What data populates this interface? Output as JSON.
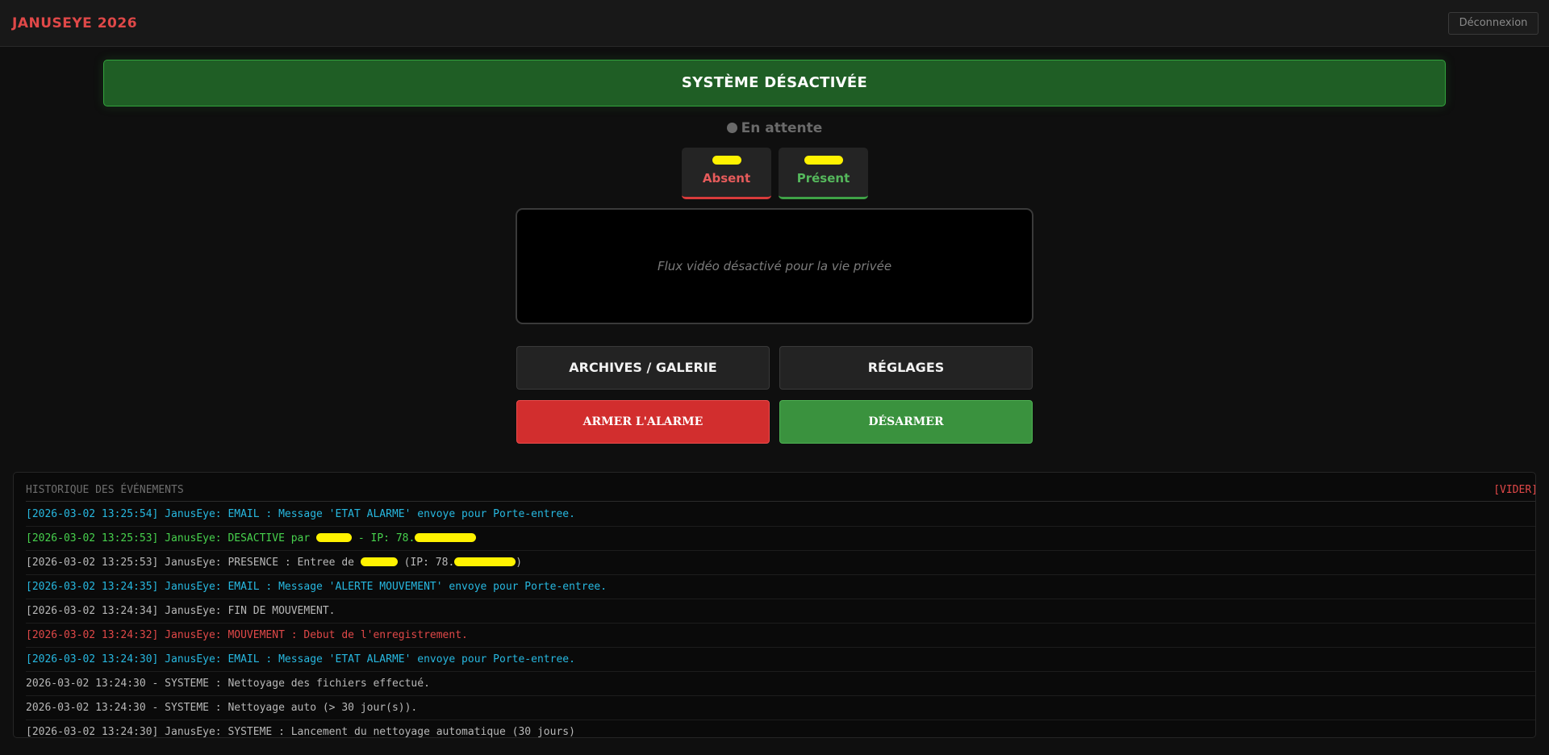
{
  "header": {
    "brand": "JANUSEYE 2026",
    "logout_label": "Déconnexion"
  },
  "status": {
    "banner": "SYSTÈME DÉSACTIVÉE",
    "waiting": "En attente"
  },
  "presence": {
    "absent_label": "Absent",
    "present_label": "Présent"
  },
  "video": {
    "placeholder": "Flux vidéo désactivé pour la vie privée"
  },
  "actions": {
    "archives": "ARCHIVES / GALERIE",
    "settings": "RÉGLAGES",
    "arm": "ARMER L'ALARME",
    "disarm": "DÉSARMER"
  },
  "log": {
    "title": "HISTORIQUE DES ÉVÉNEMENTS",
    "clear": "[VIDER]",
    "rows": [
      {
        "a": "[2026-03-02 13:25:54] JanusEye: EMAIL : Message 'ETAT ALARME' envoye pour Porte-entree.",
        "b": "",
        "c": ""
      },
      {
        "a": "[2026-03-02 13:25:53] JanusEye: DESACTIVE par ",
        "b": " - IP: 78.",
        "c": ""
      },
      {
        "a": "[2026-03-02 13:25:53] JanusEye: PRESENCE : Entree de ",
        "b": " (IP: 78.",
        "c": ")"
      },
      {
        "a": "[2026-03-02 13:24:35] JanusEye: EMAIL : Message 'ALERTE MOUVEMENT' envoye pour Porte-entree.",
        "b": "",
        "c": ""
      },
      {
        "a": "[2026-03-02 13:24:34] JanusEye: FIN DE MOUVEMENT.",
        "b": "",
        "c": ""
      },
      {
        "a": "[2026-03-02 13:24:32] JanusEye: MOUVEMENT : Debut de l'enregistrement.",
        "b": "",
        "c": ""
      },
      {
        "a": "[2026-03-02 13:24:30] JanusEye: EMAIL : Message 'ETAT ALARME' envoye pour Porte-entree.",
        "b": "",
        "c": ""
      },
      {
        "a": "2026-03-02 13:24:30 - SYSTEME : Nettoyage des fichiers effectué.",
        "b": "",
        "c": ""
      },
      {
        "a": "2026-03-02 13:24:30 - SYSTEME : Nettoyage auto (> 30 jour(s)).",
        "b": "",
        "c": ""
      },
      {
        "a": "[2026-03-02 13:24:30] JanusEye: SYSTEME : Lancement du nettoyage automatique (30 jours)",
        "b": "",
        "c": ""
      }
    ]
  },
  "colors": {
    "brand": "#e04848",
    "active_green": "#3a923e",
    "alarm_red": "#d22e2e",
    "log_info": "#27b8e0",
    "log_ok": "#47d14d",
    "redaction": "#fff200"
  }
}
